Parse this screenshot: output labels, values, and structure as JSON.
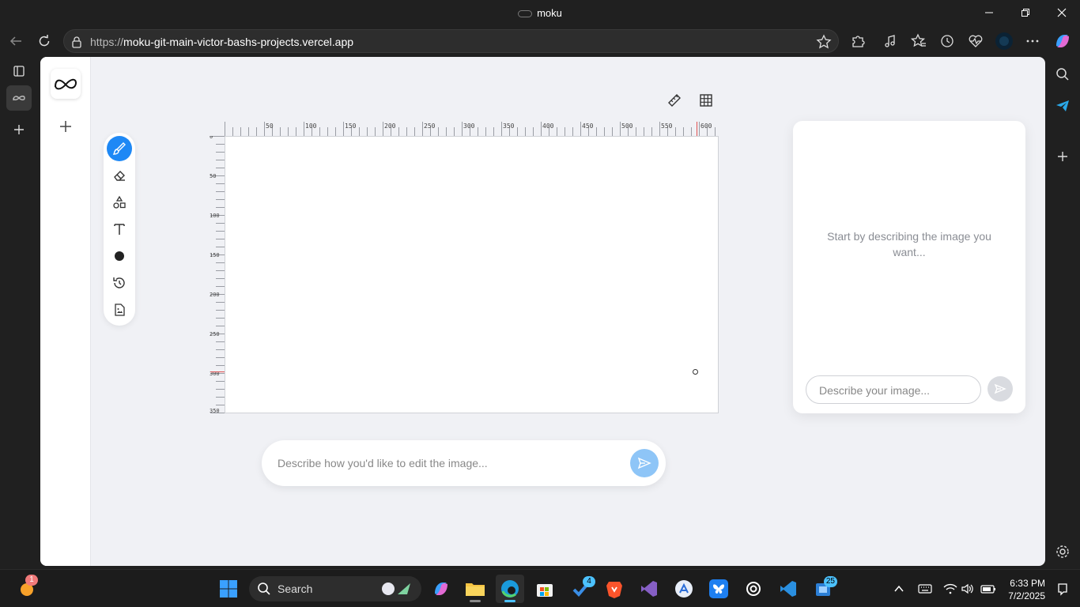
{
  "window": {
    "title": "moku"
  },
  "browser": {
    "url_prefix": "https://",
    "url_host": "moku-git-main-victor-bashs-projects.vercel.app"
  },
  "canvas": {
    "top_ruler_labels": [
      "50",
      "100",
      "150",
      "200",
      "250",
      "300",
      "350",
      "400",
      "450",
      "500",
      "550",
      "600"
    ],
    "left_ruler_labels": [
      "0",
      "50",
      "100",
      "150",
      "200",
      "250",
      "300",
      "350"
    ]
  },
  "tools": {
    "items": [
      "brush-icon",
      "eraser-icon",
      "shapes-icon",
      "text-icon",
      "color-swatch",
      "history-icon",
      "image-file-icon"
    ],
    "active": "brush-icon",
    "accent_color": "#1e88f5",
    "swatch_color": "#222222"
  },
  "edit_bar": {
    "placeholder": "Describe how you'd like to edit the image..."
  },
  "chat": {
    "empty_hint": "Start by describing the image you want...",
    "placeholder": "Describe your image..."
  },
  "taskbar": {
    "search_label": "Search",
    "notification_badge": "1",
    "todo_badge": "4",
    "store_badge": "25",
    "time": "6:33 PM",
    "date": "7/2/2025"
  }
}
